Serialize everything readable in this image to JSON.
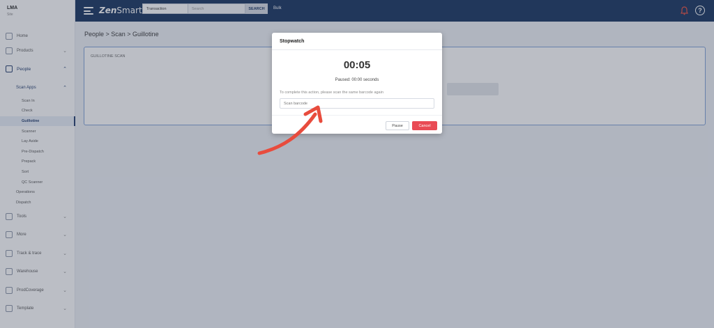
{
  "sidebar": {
    "brand_name": "LMA",
    "brand_sub": "Site",
    "items": {
      "home": "Home",
      "products": "Products",
      "people": "People",
      "scan_apps": "Scan Apps",
      "tools": "Tools",
      "more": "More",
      "track_and_trace": "Track & trace",
      "warehouse": "Warehouse",
      "prodcoverage": "ProdCoverage",
      "template": "Template"
    },
    "sub_items": [
      "Scan In",
      "Check",
      "Guillotine",
      "Scanner",
      "Lay Aside",
      "Pre-Dispatch",
      "Prepack",
      "Sort",
      "QC Scanner",
      "Operations",
      "Dispatch"
    ],
    "active_sub": "Guillotine"
  },
  "topbar": {
    "logo_prefix": "Zen",
    "logo_suffix": "Smart",
    "search_type": "Transaction",
    "search_placeholder": "Search",
    "search_button": "SEARCH",
    "bulk_label": "Bulk",
    "help_symbol": "?"
  },
  "main": {
    "breadcrumb": "People > Scan > Guillotine",
    "panel_title": "GUILLOTINE SCAN"
  },
  "modal": {
    "title": "Stopwatch",
    "timer": "00:05",
    "paused_text": "Paused: 00:00 seconds",
    "instruction": "To complete this action, please scan the same barcode again",
    "scan_placeholder": "Scan barcode",
    "pause_label": "Pause",
    "cancel_label": "Cancel"
  },
  "colors": {
    "topbar": "#13315c",
    "cancel": "#e94b55",
    "arrow": "#e84c3d",
    "panel_border": "#7fa0d6"
  }
}
